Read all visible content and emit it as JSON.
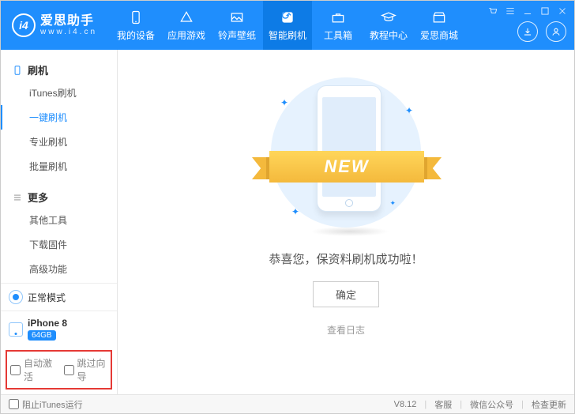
{
  "brand": {
    "name": "爱思助手",
    "domain": "www.i4.cn",
    "badge": "i4"
  },
  "nav": [
    {
      "label": "我的设备"
    },
    {
      "label": "应用游戏"
    },
    {
      "label": "铃声壁纸"
    },
    {
      "label": "智能刷机"
    },
    {
      "label": "工具箱"
    },
    {
      "label": "教程中心"
    },
    {
      "label": "爱思商城"
    }
  ],
  "nav_active_index": 3,
  "sidebar": {
    "sections": [
      {
        "title": "刷机",
        "items": [
          "iTunes刷机",
          "一键刷机",
          "专业刷机",
          "批量刷机"
        ],
        "active_index": 1
      },
      {
        "title": "更多",
        "items": [
          "其他工具",
          "下载固件",
          "高级功能"
        ],
        "active_index": -1
      }
    ],
    "mode": "正常模式",
    "device": {
      "name": "iPhone 8",
      "capacity": "64GB"
    },
    "bottom_options": [
      "自动激活",
      "跳过向导"
    ]
  },
  "main": {
    "ribbon": "NEW",
    "message": "恭喜您，保资料刷机成功啦！",
    "confirm": "确定",
    "log_link": "查看日志"
  },
  "statusbar": {
    "prevent_itunes": "阻止iTunes运行",
    "version": "V8.12",
    "cs": "客服",
    "wechat": "微信公众号",
    "update": "检查更新"
  }
}
